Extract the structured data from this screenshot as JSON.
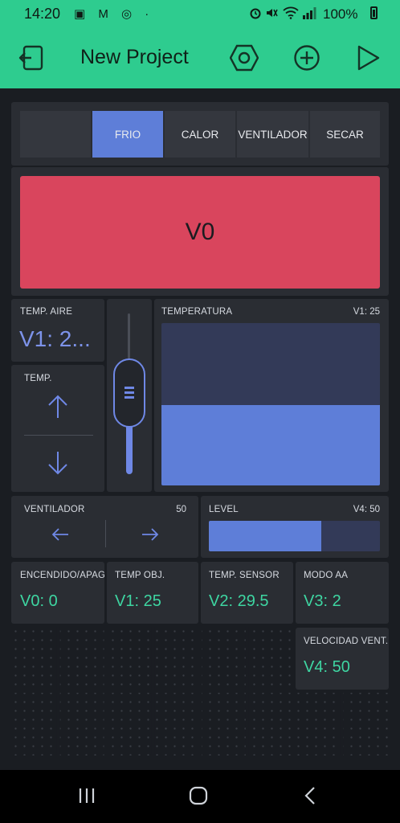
{
  "status_bar": {
    "time": "14:20",
    "battery": "100%",
    "notification_icons": [
      "image-icon",
      "gmail-icon",
      "sync-icon",
      "dot"
    ]
  },
  "app_bar": {
    "title": "New Project"
  },
  "mode_selector": {
    "segments": [
      "",
      "FRIO",
      "CALOR",
      "VENTILADOR",
      "SECAR"
    ],
    "selected": "FRIO"
  },
  "button_v0": {
    "label": "V0",
    "color": "#d9455d"
  },
  "temp_aire": {
    "label": "TEMP. AIRE",
    "value": "V1: 2..."
  },
  "temp_stepper": {
    "label": "TEMP."
  },
  "vertical_slider": {
    "level": 0.5
  },
  "temperatura_gauge": {
    "label": "TEMPERATURA",
    "pin": "V1: 25",
    "fill": 0.5
  },
  "ventilador": {
    "label": "VENTILADOR",
    "value": "50"
  },
  "level_bar": {
    "label": "LEVEL",
    "pin": "V4: 50",
    "fill": 0.65
  },
  "displays": [
    {
      "label": "ENCENDIDO/APAGA",
      "value": "V0: 0"
    },
    {
      "label": "TEMP OBJ.",
      "value": "V1: 25"
    },
    {
      "label": "TEMP. SENSOR",
      "value": "V2: 29.5"
    },
    {
      "label": "MODO AA",
      "value": "V3: 2"
    },
    {
      "label": "VELOCIDAD VENT.",
      "value": "V4: 50"
    }
  ],
  "colors": {
    "accent": "#2ecc8f",
    "widget_blue": "#5e7ed8",
    "value_green": "#3ed6a2",
    "button_red": "#d9455d"
  }
}
